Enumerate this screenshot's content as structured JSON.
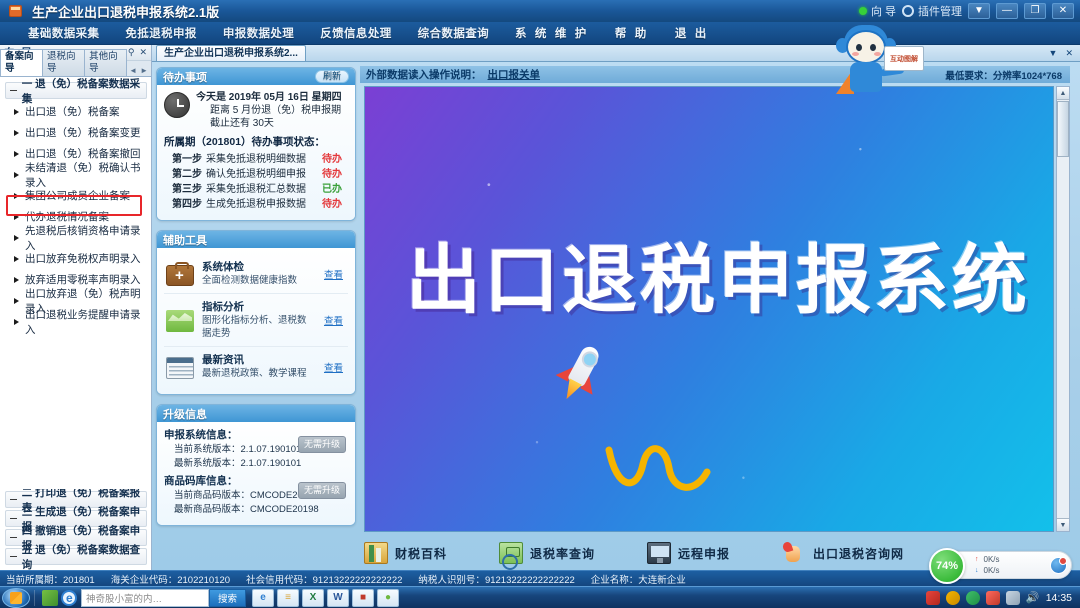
{
  "window": {
    "title": "生产企业出口退税申报系统2.1版",
    "tray_wizard": "向 导",
    "tray_plugin": "插件管理",
    "btn_dropdown": "▼",
    "btn_minimize": "—",
    "btn_restore": "❐",
    "btn_close": "✕"
  },
  "menubar": {
    "items": [
      "基础数据采集",
      "免抵退税申报",
      "申报数据处理",
      "反馈信息处理",
      "综合数据查询",
      "系 统 维 护",
      "帮 助",
      "退 出"
    ]
  },
  "sidebar": {
    "panel_title": "向 导",
    "pin": "⚲",
    "close": "✕",
    "tabs": [
      {
        "label": "备案向导",
        "active": true
      },
      {
        "label": "退税向导",
        "active": false
      },
      {
        "label": "其他向导",
        "active": false
      }
    ],
    "tab_arrows": [
      "◄",
      "►"
    ],
    "group_one": "一 退（免）税备案数据采集",
    "items": [
      "出口退（免）税备案",
      "出口退（免）税备案变更",
      "出口退（免）税备案撤回",
      "未结清退（免）税确认书录入",
      "集团公司成员企业备案",
      "代办退税情况备案",
      "先退税后核销资格申请录入",
      "出口放弃免税权声明录入",
      "放弃适用零税率声明录入",
      "出口放弃退（免）税声明录入",
      "出口退税业务提醒申请录入"
    ],
    "highlighted_item": "出口退（免）税备案变更",
    "footer_groups": [
      "二 打印退（免）税备案报表",
      "三 生成退（免）税备案申报",
      "四 撤销退（免）税备案申报",
      "五 退（免）税备案数据查询"
    ]
  },
  "document_tab": {
    "label": "生产企业出口退税申报系统2...",
    "minimize": "▼",
    "close": "✕"
  },
  "topinfo": {
    "label": "外部数据读入操作说明：",
    "link": "出口报关单",
    "requirement": "最低要求：分辨率1024*768"
  },
  "todo_card": {
    "title": "待办事项",
    "refresh": "刷新",
    "today_line": "今天是 2019年 05月 16日 星期四",
    "deadline_line": "距离 5 月份退（免）税申报期截止还有 30天",
    "status_title": "所属期（201801）待办事项状态：",
    "steps": [
      {
        "no": "第一步",
        "name": "采集免抵退税明细数据",
        "status": "待办",
        "state": "pending"
      },
      {
        "no": "第二步",
        "name": "确认免抵退税明细申报",
        "status": "待办",
        "state": "pending"
      },
      {
        "no": "第三步",
        "name": "采集免抵退税汇总数据",
        "status": "已办",
        "state": "done"
      },
      {
        "no": "第四步",
        "name": "生成免抵退税申报数据",
        "status": "待办",
        "state": "pending"
      }
    ]
  },
  "tools_card": {
    "title": "辅助工具",
    "rows": [
      {
        "name": "系统体检",
        "desc": "全面检测数据健康指数",
        "link": "查看",
        "icon": "briefcase-icon"
      },
      {
        "name": "指标分析",
        "desc": "图形化指标分析、退税数据走势",
        "link": "查看",
        "icon": "chart-icon"
      },
      {
        "name": "最新资讯",
        "desc": "最新退税政策、教学课程",
        "link": "查看",
        "icon": "news-icon"
      }
    ]
  },
  "upgrade_card": {
    "title": "升级信息",
    "sys_title": "申报系统信息：",
    "sys_current_label": "当前系统版本：",
    "sys_current_value": "2.1.07.190101",
    "sys_latest_label": "最新系统版本：",
    "sys_latest_value": "2.1.07.190101",
    "sys_button": "无需升级",
    "goods_title": "商品码库信息：",
    "goods_current_label": "当前商品码版本：",
    "goods_current_value": "CMCODE20198",
    "goods_latest_label": "最新商品码版本：",
    "goods_latest_value": "CMCODE20198",
    "goods_button": "无需升级"
  },
  "banner": {
    "headline": "出口退税申报系统",
    "mascot_screen_text": "互动图解"
  },
  "quickbar": {
    "buttons": [
      {
        "label": "财税百科",
        "icon": "books-icon"
      },
      {
        "label": "退税率查询",
        "icon": "money-search-icon"
      },
      {
        "label": "远程申报",
        "icon": "monitor-icon"
      },
      {
        "label": "出口退税咨询网",
        "icon": "hand-icon"
      }
    ]
  },
  "statusbar": {
    "period_label": "当前所属期：",
    "period_value": "201801",
    "customs_label": "海关企业代码：",
    "customs_value": "2102210120",
    "credit_label": "社会信用代码：",
    "credit_value": "91213222222222222",
    "taxpayer_label": "纳税人识别号：",
    "taxpayer_value": "91213222222222222",
    "company_label": "企业名称：",
    "company_value": "大连新企业"
  },
  "taskbar": {
    "search_placeholder": "神奇股小富的内…",
    "search_button": "搜索",
    "apps": [
      "e",
      "≡",
      "X",
      "W",
      "■",
      "●"
    ],
    "clock": "14:35"
  },
  "perf_widget": {
    "percent": "74%",
    "up_speed": "0K/s",
    "down_speed": "0K/s",
    "up_arrow": "↑",
    "down_arrow": "↓"
  }
}
